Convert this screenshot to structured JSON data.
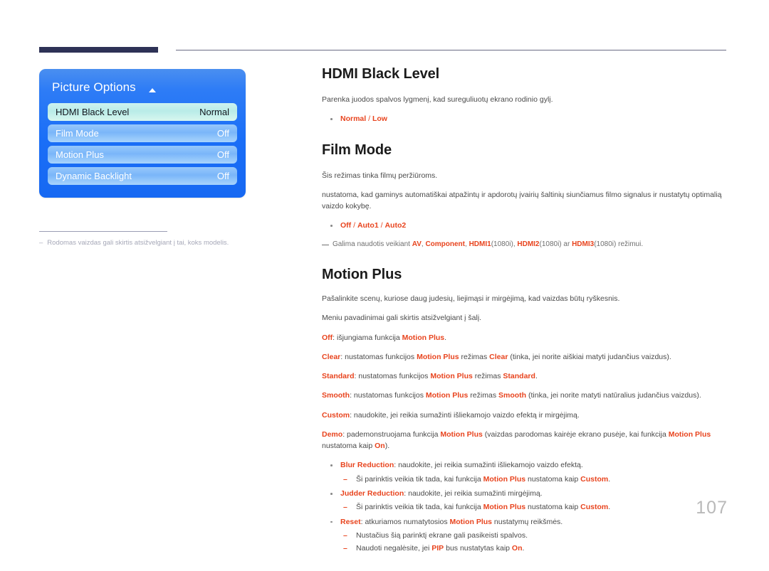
{
  "page": {
    "number": "107"
  },
  "osd": {
    "title": "Picture Options",
    "arrow_icon": "triangle-up-icon",
    "rows": [
      {
        "label": "HDMI Black Level",
        "value": "Normal",
        "selected": true
      },
      {
        "label": "Film Mode",
        "value": "Off",
        "selected": false
      },
      {
        "label": "Motion Plus",
        "value": "Off",
        "selected": false
      },
      {
        "label": "Dynamic Backlight",
        "value": "Off",
        "selected": false
      }
    ]
  },
  "left_note": {
    "dash": "–",
    "text": "Rodomas vaizdas gali skirtis atsižvelgiant į tai, koks modelis."
  },
  "sections": {
    "hdmi_black_level": {
      "heading": "HDMI Black Level",
      "intro": "Parenka juodos spalvos lygmenį, kad sureguliuotų ekrano rodinio gylį.",
      "options_bullet": {
        "first": "Normal",
        "separator": " / ",
        "second": "Low"
      }
    },
    "film_mode": {
      "heading": "Film Mode",
      "para1": "Šis režimas tinka filmų peržiūroms.",
      "para2": "nustatoma, kad gaminys automatiškai atpažintų ir apdorotų įvairių šaltinių siunčiamus filmo signalus ir nustatytų optimalią vaizdo kokybę.",
      "options_bullet": {
        "opt1": "Off",
        "sep1": " / ",
        "opt2": "Auto1",
        "sep2": " / ",
        "opt3": "Auto2"
      },
      "note": {
        "lead": "Galima naudotis veikiant ",
        "av": "AV",
        "comma1": ", ",
        "component": "Component",
        "comma2": ", ",
        "hdmi1": "HDMI1",
        "hdmi1_suffix": "(1080i), ",
        "hdmi2": "HDMI2",
        "hdmi2_suffix": "(1080i) ar ",
        "hdmi3": "HDMI3",
        "hdmi3_suffix": "(1080i) režimui."
      }
    },
    "motion_plus": {
      "heading": "Motion Plus",
      "para1": "Pašalinkite scenų, kuriose daug judesių, liejimąsi ir mirgėjimą, kad vaizdas būtų ryškesnis.",
      "para2": "Meniu pavadinimai gali skirtis atsižvelgiant į šalį.",
      "modes": {
        "off": {
          "term": "Off",
          "text1": ": išjungiama funkcija ",
          "ref": "Motion Plus",
          "text2": "."
        },
        "clear": {
          "term": "Clear",
          "text1": ": nustatomas funkcijos ",
          "ref": "Motion Plus",
          "text2": " režimas ",
          "value": "Clear",
          "text3": " (tinka, jei norite aiškiai matyti judančius vaizdus)."
        },
        "standard": {
          "term": "Standard",
          "text1": ": nustatomas funkcijos ",
          "ref": "Motion Plus",
          "text2": " režimas ",
          "value": "Standard",
          "text3": "."
        },
        "smooth": {
          "term": "Smooth",
          "text1": ": nustatomas funkcijos ",
          "ref": "Motion Plus",
          "text2": " režimas ",
          "value": "Smooth",
          "text3": " (tinka, jei norite matyti natūralius judančius vaizdus)."
        },
        "custom": {
          "term": "Custom",
          "text1": ": naudokite, jei reikia sumažinti išliekamojo vaizdo efektą ir mirgėjimą."
        },
        "demo": {
          "term": "Demo",
          "text1": ": pademonstruojama funkcija ",
          "ref1": "Motion Plus",
          "text2": " (vaizdas parodomas kairėje ekrano pusėje, kai funkcija ",
          "ref2": "Motion Plus",
          "text3": " nustatoma kaip ",
          "value": "On",
          "text4": ")."
        }
      },
      "sub_items": [
        {
          "term": "Blur Reduction",
          "text": ": naudokite, jei reikia sumažinti išliekamojo vaizdo efektą.",
          "notes": [
            {
              "lead": "Ši parinktis veikia tik tada, kai funkcija ",
              "ref": "Motion Plus",
              "mid": " nustatoma kaip ",
              "value": "Custom",
              "tail": "."
            }
          ]
        },
        {
          "term": "Judder Reduction",
          "text": ": naudokite, jei reikia sumažinti mirgėjimą.",
          "notes": [
            {
              "lead": "Ši parinktis veikia tik tada, kai funkcija ",
              "ref": "Motion Plus",
              "mid": " nustatoma kaip ",
              "value": "Custom",
              "tail": "."
            }
          ]
        },
        {
          "term": "Reset",
          "text_pre": ": atkuriamos numatytosios ",
          "ref": "Motion Plus",
          "text_post": " nustatymų reikšmės.",
          "notes": [
            {
              "lead": "Nustačius šią parinktį ekrane gali pasikeisti spalvos.",
              "ref": "",
              "mid": "",
              "value": "",
              "tail": ""
            },
            {
              "lead": "Naudoti negalėsite, jei ",
              "ref": "PIP",
              "mid": " bus nustatytas kaip ",
              "value": "On",
              "tail": "."
            }
          ]
        }
      ]
    }
  },
  "colors": {
    "highlight": "#e8441e",
    "header_bar": "#2e3256",
    "osd_blue": "#1a6ef7",
    "page_number": "#b9b9b9"
  }
}
